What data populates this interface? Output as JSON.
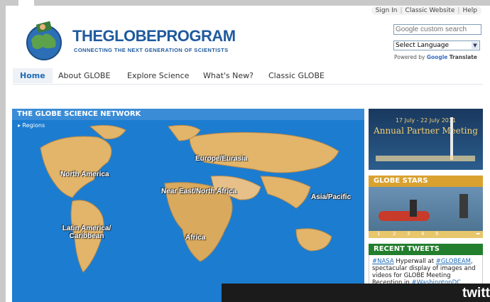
{
  "toplinks": [
    "Sign In",
    "Classic Website",
    "Help"
  ],
  "logo": {
    "title": "THEGLOBEPROGRAM",
    "subtitle": "CONNECTING THE NEXT GENERATION OF SCIENTISTS"
  },
  "search": {
    "placeholder": "Google custom search"
  },
  "language": {
    "selected": "Select Language"
  },
  "powered_by": {
    "prefix": "Powered by",
    "brand": "Google",
    "suffix": "Translate"
  },
  "nav": [
    "Home",
    "About GLOBE",
    "Explore Science",
    "What's New?",
    "Classic GLOBE"
  ],
  "map": {
    "title": "THE GLOBE SCIENCE NETWORK",
    "regions_link": "▸ Regions",
    "regions": [
      "North America",
      "Europe/Eurasia",
      "Near East/North Africa",
      "Asia/Pacific",
      "Latin America/ Caribbean",
      "Africa"
    ]
  },
  "partner": {
    "dates": "17 July - 22 July 2011",
    "title": "Annual Partner Meeting"
  },
  "stars": {
    "title": "GLOBE STARS",
    "pages": [
      "1",
      "2",
      "3",
      "4",
      "5"
    ]
  },
  "tweets": {
    "title": "RECENT TWEETS",
    "text_pre": "#NASA",
    "text_mid": " Hyperwall at ",
    "text_tag": "#GLOBEAM",
    "text_post": ", spectacular display of images and videos for GLOBE Meeting Reception in ",
    "text_end": "#WashingtonDC"
  },
  "twitter": {
    "label": "twitt"
  },
  "colors": {
    "brand": "#1f5a9f",
    "map_bg": "#1c7cd0",
    "stars": "#d9a230",
    "tweets": "#237e2e"
  }
}
